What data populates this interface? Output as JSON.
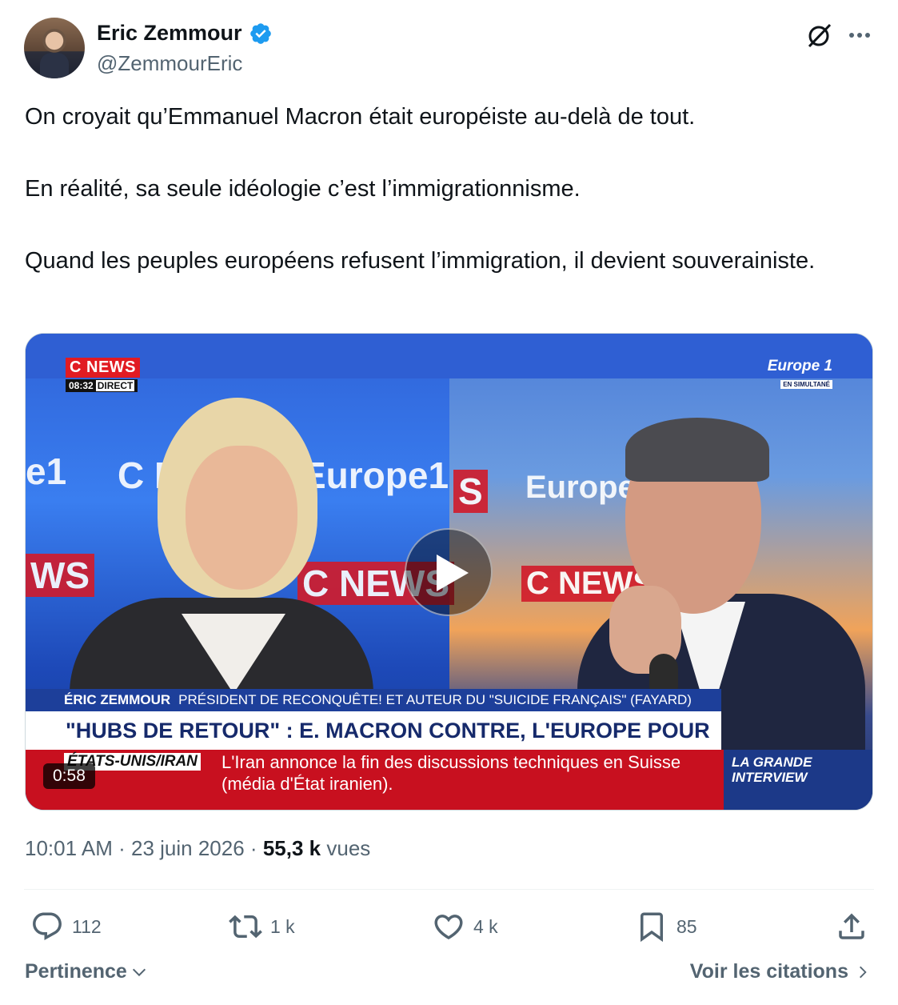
{
  "author": {
    "name": "Eric Zemmour",
    "handle": "@ZemmourEric",
    "verified_color": "#1d9bf0"
  },
  "tweet": {
    "paragraphs": [
      "On croyait qu’Emmanuel Macron était européiste au-delà de tout.",
      "En réalité, sa seule idéologie c’est l’immigrationnisme.",
      "Quand les peuples européens refusent l’immigration, il devient souverainiste."
    ]
  },
  "video": {
    "duration": "0:58",
    "channel_logo": "C NEWS",
    "clock": "08:32",
    "live_label": "DIRECT",
    "partner_logo": "Europe 1",
    "partner_sub": "EN SIMULTANÉ",
    "wall_left_1": "e1",
    "wall_left_2": "C N",
    "wall_left_3": "Europe1",
    "wall_left_4": "WS",
    "wall_left_5": "C NEWS",
    "wall_right_1": "S",
    "wall_right_2": "Europe",
    "wall_right_3": "C NEWS",
    "lower_third_name": "ÉRIC ZEMMOUR",
    "lower_third_title": "PRÉSIDENT DE RECONQUÊTE! ET AUTEUR DU \"SUICIDE FRANÇAIS\" (FAYARD)",
    "headline": "\"HUBS DE RETOUR\" : E. MACRON CONTRE, L'EUROPE POUR",
    "ticker_tag": "ÉTATS-UNIS/IRAN",
    "ticker_text": "L'Iran annonce la fin des discussions techniques en Suisse (média d'État iranien).",
    "show_name_1": "LA GRANDE",
    "show_name_2": "INTERVIEW"
  },
  "meta": {
    "time": "10:01 AM",
    "separator": "·",
    "date": "23 juin 2026",
    "views_count": "55,3 k",
    "views_label": "vues"
  },
  "actions": {
    "replies": "112",
    "reposts": "1 k",
    "likes": "4 k",
    "bookmarks": "85"
  },
  "footer": {
    "sort_label": "Pertinence",
    "quotes_label": "Voir les citations"
  },
  "icons": {
    "grok": "grok-icon",
    "more": "more-icon",
    "reply": "reply-icon",
    "repost": "repost-icon",
    "like": "heart-icon",
    "bookmark": "bookmark-icon",
    "share": "share-icon",
    "play": "play-icon"
  }
}
